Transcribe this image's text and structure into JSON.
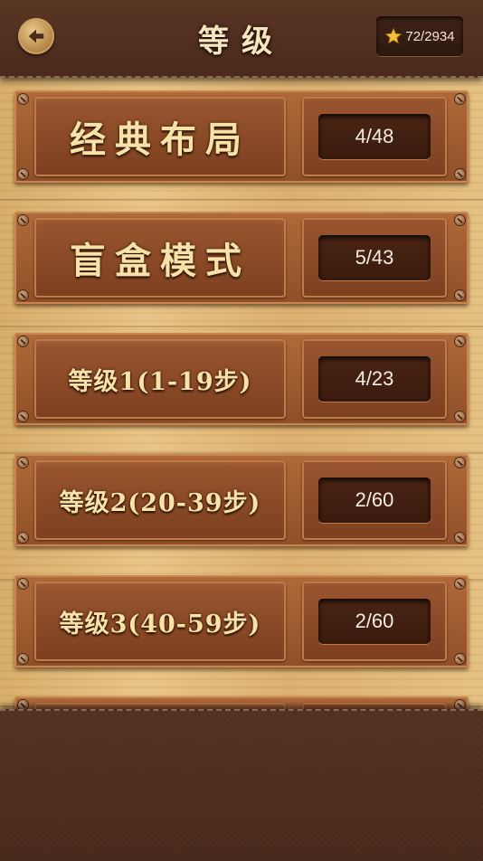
{
  "header": {
    "title": "等级",
    "stars": "72/2934",
    "back_icon": "back-arrow-icon",
    "star_icon": "star-icon"
  },
  "levels": [
    {
      "label": "经典布局",
      "count": "4/48"
    },
    {
      "label": "盲盒模式",
      "count": "5/43"
    },
    {
      "label": "等级1(1-19步)",
      "count": "4/23"
    },
    {
      "label": "等级2(20-39步)",
      "count": "2/60"
    },
    {
      "label": "等级3(40-59步)",
      "count": "2/60"
    }
  ],
  "colors": {
    "leather": "#4a2c1c",
    "wood": "#e2bd7c",
    "panel": "#8f4f27",
    "label_text": "#f7e2a8"
  }
}
